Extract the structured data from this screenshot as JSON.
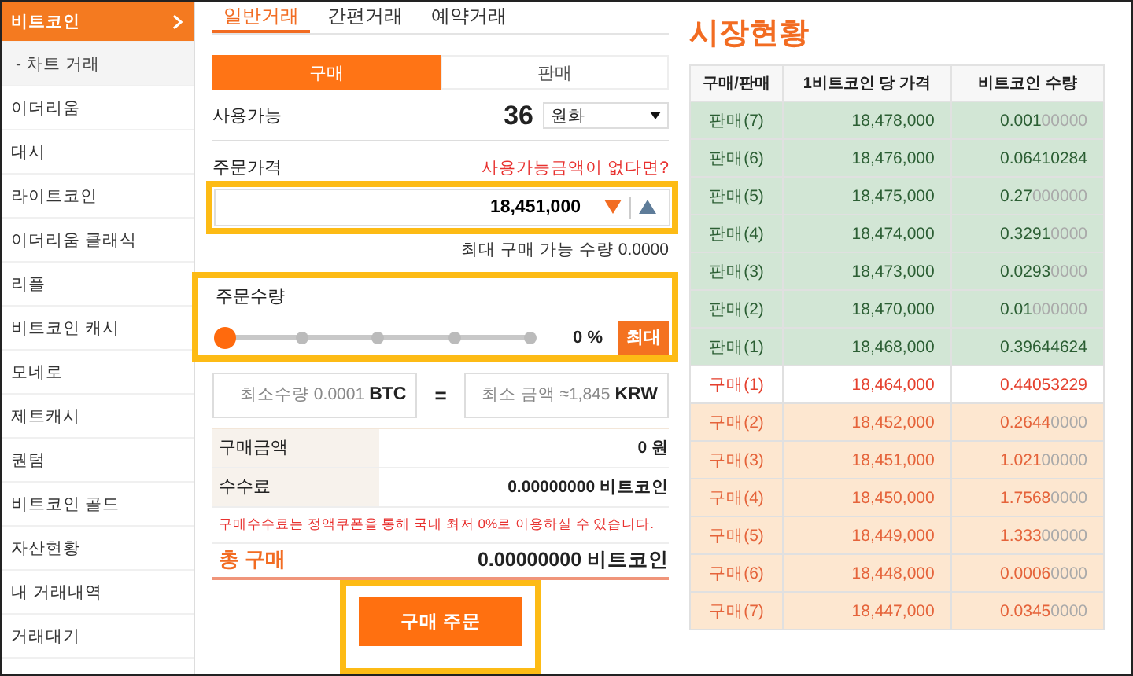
{
  "sidebar": {
    "items": [
      {
        "label": "비트코인",
        "kind": "coin",
        "selected": true
      },
      {
        "label": "- 차트 거래",
        "kind": "sub",
        "selected": false
      },
      {
        "label": "이더리움",
        "kind": "coin",
        "selected": false
      },
      {
        "label": "대시",
        "kind": "coin",
        "selected": false
      },
      {
        "label": "라이트코인",
        "kind": "coin",
        "selected": false
      },
      {
        "label": "이더리움 클래식",
        "kind": "coin",
        "selected": false
      },
      {
        "label": "리플",
        "kind": "coin",
        "selected": false
      },
      {
        "label": "비트코인 캐시",
        "kind": "coin",
        "selected": false
      },
      {
        "label": "모네로",
        "kind": "coin",
        "selected": false
      },
      {
        "label": "제트캐시",
        "kind": "coin",
        "selected": false
      },
      {
        "label": "퀀텀",
        "kind": "coin",
        "selected": false
      },
      {
        "label": "비트코인 골드",
        "kind": "coin",
        "selected": false
      },
      {
        "label": "자산현황",
        "kind": "coin",
        "selected": false
      },
      {
        "label": "내 거래내역",
        "kind": "coin",
        "selected": false
      },
      {
        "label": "거래대기",
        "kind": "coin",
        "selected": false
      }
    ]
  },
  "tabs": [
    {
      "label": "일반거래",
      "selected": true
    },
    {
      "label": "간편거래",
      "selected": false
    },
    {
      "label": "예약거래",
      "selected": false
    }
  ],
  "side_toggle": [
    {
      "label": "구매",
      "selected": true
    },
    {
      "label": "판매",
      "selected": false
    }
  ],
  "available": {
    "label": "사용가능",
    "amount": "36",
    "currency": "원화"
  },
  "price": {
    "label": "주문가격",
    "link": "사용가능금액이 없다면?",
    "value": "18,451,000",
    "highlighted": true,
    "max_note": "최대 구매 가능 수량 0.0000"
  },
  "quantity": {
    "label": "주문수량",
    "level": 0,
    "reading": "0 %",
    "max_button": "최대",
    "highlighted": true
  },
  "minimums": {
    "quantity_placeholder": "최소수량 0.0001",
    "quantity_unit": "BTC",
    "equals": "=",
    "amount_placeholder": "최소 금액 ≈1,845",
    "amount_unit": "KRW"
  },
  "summary": [
    {
      "label": "구매금액",
      "value": "0 원"
    },
    {
      "label": "수수료",
      "value": "0.00000000 비트코인"
    }
  ],
  "notice": "구매수수료는 정액쿠폰을 통해 국내 최저 0%로 이용하실 수 있습니다.",
  "total": {
    "label": "총 구매",
    "value": "0.00000000 비트코인"
  },
  "order_button": {
    "label": "구매 주문",
    "highlighted": true
  },
  "market": {
    "title": "시장현황",
    "columns": [
      "구매/판매",
      "1비트코인 당 가격",
      "비트코인 수량"
    ],
    "rows": [
      {
        "kind": "sell",
        "label": "판매(7)",
        "price": "18,478,000",
        "quantity": "0.00100000"
      },
      {
        "kind": "sell",
        "label": "판매(6)",
        "price": "18,476,000",
        "quantity": "0.06410284"
      },
      {
        "kind": "sell",
        "label": "판매(5)",
        "price": "18,475,000",
        "quantity": "0.27000000"
      },
      {
        "kind": "sell",
        "label": "판매(4)",
        "price": "18,474,000",
        "quantity": "0.32910000"
      },
      {
        "kind": "sell",
        "label": "판매(3)",
        "price": "18,473,000",
        "quantity": "0.02930000"
      },
      {
        "kind": "sell",
        "label": "판매(2)",
        "price": "18,470,000",
        "quantity": "0.01000000"
      },
      {
        "kind": "sell",
        "label": "판매(1)",
        "price": "18,468,000",
        "quantity": "0.39644624"
      },
      {
        "kind": "current",
        "label": "구매(1)",
        "price": "18,464,000",
        "quantity": "0.44053229"
      },
      {
        "kind": "buy",
        "label": "구매(2)",
        "price": "18,452,000",
        "quantity": "0.26440000"
      },
      {
        "kind": "buy",
        "label": "구매(3)",
        "price": "18,451,000",
        "quantity": "1.02100000"
      },
      {
        "kind": "buy",
        "label": "구매(4)",
        "price": "18,450,000",
        "quantity": "1.75680000"
      },
      {
        "kind": "buy",
        "label": "구매(5)",
        "price": "18,449,000",
        "quantity": "1.33300000"
      },
      {
        "kind": "buy",
        "label": "구매(6)",
        "price": "18,448,000",
        "quantity": "0.00060000"
      },
      {
        "kind": "buy",
        "label": "구매(7)",
        "price": "18,447,000",
        "quantity": "0.03450000"
      }
    ]
  }
}
